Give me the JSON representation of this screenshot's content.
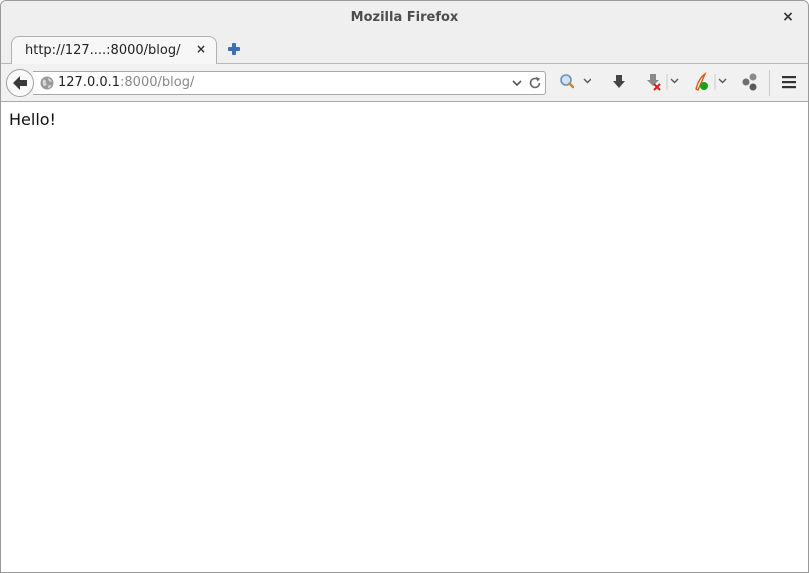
{
  "window": {
    "title": "Mozilla Firefox",
    "close_glyph": "×"
  },
  "tabs": [
    {
      "title": "http://127....:8000/blog/",
      "close_glyph": "×"
    }
  ],
  "urlbar": {
    "host": "127.0.0.1",
    "rest": ":8000/blog/"
  },
  "icons": {
    "back": "back-arrow-icon",
    "site": "globe-icon",
    "dropdown": "chevron-down-icon",
    "reload": "reload-icon",
    "search": "search-icon",
    "downloads": "download-arrow-icon",
    "addon_blocked": "addon-download-blocked-icon",
    "addon_pen": "pen-addon-icon",
    "share": "share-icon",
    "menu": "hamburger-menu-icon"
  },
  "colors": {
    "new_tab_plus": "#3b6fb6",
    "addon_badge_green": "#1aa31a",
    "addon_badge_red": "#d42020"
  },
  "page": {
    "body_text": "Hello!"
  }
}
